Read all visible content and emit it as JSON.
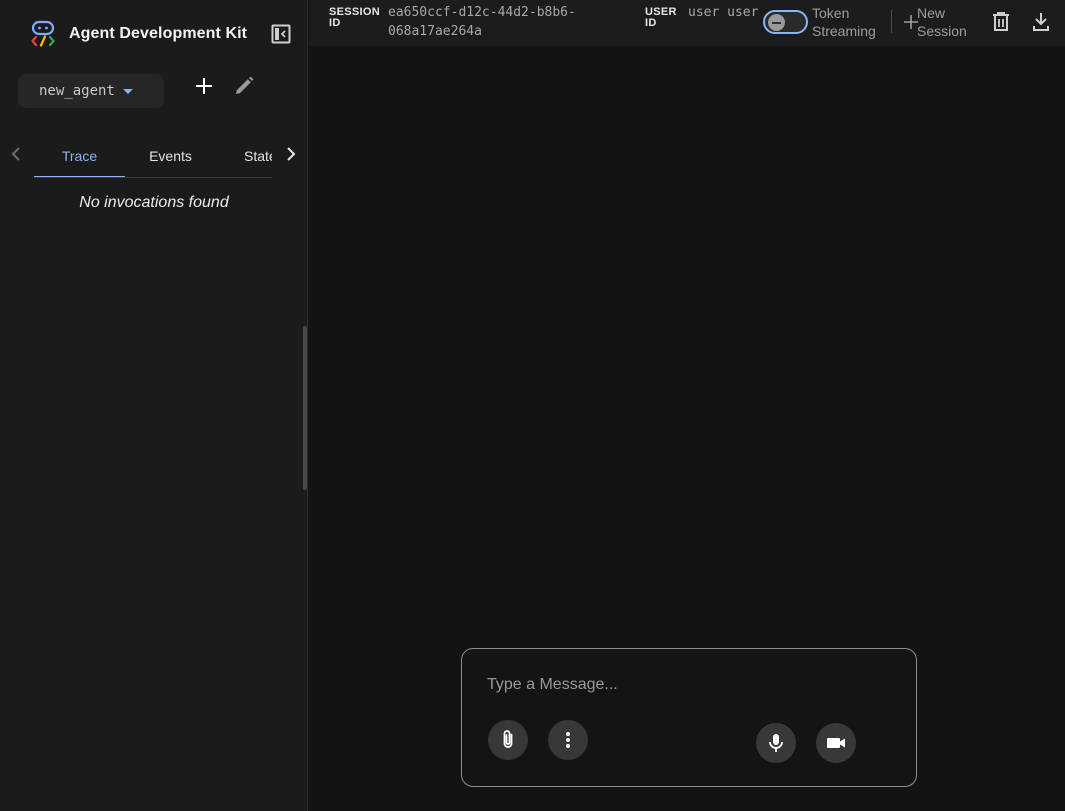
{
  "sidebar": {
    "brand_title": "Agent Development Kit",
    "agent_selected": "new_agent",
    "tabs": [
      {
        "label": "Trace",
        "active": true
      },
      {
        "label": "Events",
        "active": false
      },
      {
        "label": "State",
        "active": false
      }
    ],
    "empty_message": "No invocations found"
  },
  "header": {
    "session_label": "SESSION ID",
    "session_id": "ea650ccf-d12c-44d2-b8b6-068a17ae264a",
    "user_label": "USER ID",
    "user_id": "user user",
    "token_streaming_label": "Token Streaming",
    "token_streaming_on": false,
    "new_session_label": "New Session"
  },
  "composer": {
    "placeholder": "Type a Message..."
  },
  "icons": {
    "logo": "adk-logo-icon",
    "collapse": "dock-left-icon",
    "add": "plus-icon",
    "edit": "pencil-icon",
    "tabs_prev": "chevron-left-icon",
    "tabs_next": "chevron-right-icon",
    "delete": "trash-icon",
    "download": "download-icon",
    "attach": "paperclip-icon",
    "more": "more-vert-icon",
    "mic": "mic-icon",
    "video": "videocam-icon"
  },
  "colors": {
    "accent": "#8ab4f8",
    "background": "#131313",
    "sidebar": "#1b1b1b",
    "header": "#1c1c1c"
  }
}
